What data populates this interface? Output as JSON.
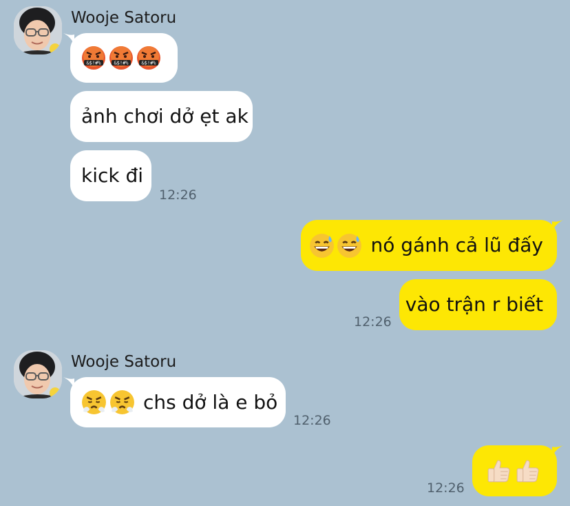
{
  "groups": [
    {
      "sender": "Wooje Satoru",
      "avatar_icon": "profile-photo",
      "messages": [
        {
          "emojis": [
            "cursing-face-emoji",
            "cursing-face-emoji",
            "cursing-face-emoji"
          ],
          "text": ""
        },
        {
          "text": "ảnh chơi dở ẹt ak"
        },
        {
          "text": "kick đi"
        }
      ],
      "time": "12:26"
    },
    {
      "sender": "me",
      "messages": [
        {
          "emojis": [
            "grinning-sweat-emoji",
            "grinning-sweat-emoji"
          ],
          "text": "nó gánh cả lũ đấy"
        },
        {
          "text": "vào trận r biết"
        }
      ],
      "time": "12:26"
    },
    {
      "sender": "Wooje Satoru",
      "avatar_icon": "profile-photo",
      "messages": [
        {
          "emojis": [
            "huffing-face-emoji",
            "huffing-face-emoji"
          ],
          "text": "chs dở là e bỏ"
        }
      ],
      "time": "12:26"
    },
    {
      "sender": "me",
      "messages": [
        {
          "emojis": [
            "thumbs-up-emoji",
            "thumbs-up-emoji"
          ],
          "text": ""
        }
      ],
      "time": "12:26"
    }
  ],
  "colors": {
    "background": "#abc1d1",
    "incoming_bubble": "#ffffff",
    "outgoing_bubble": "#fde704",
    "timestamp": "#50606d"
  }
}
